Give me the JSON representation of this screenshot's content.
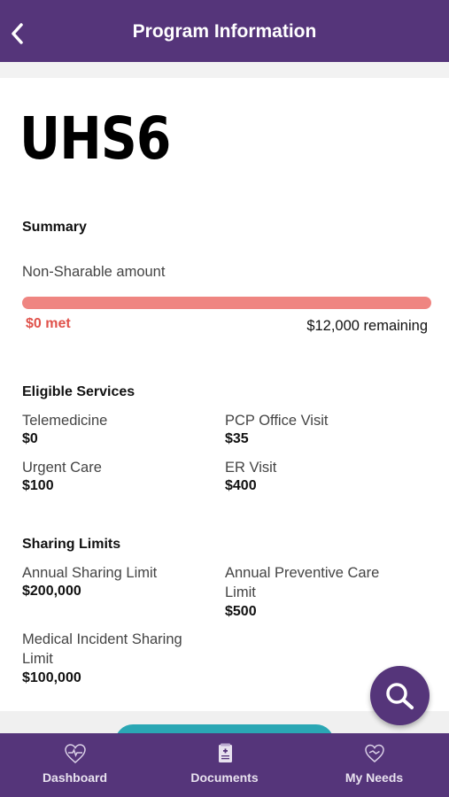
{
  "header": {
    "title": "Program Information"
  },
  "program": {
    "name": "UHS6"
  },
  "summary": {
    "title": "Summary",
    "label": "Non-Sharable amount",
    "met": "$0 met",
    "remaining": "$12,000 remaining",
    "progress_fraction": 0.0,
    "colors": {
      "track": "#ef8581",
      "met": "#e0524b"
    }
  },
  "eligible": {
    "title": "Eligible Services",
    "items": [
      {
        "label": "Telemedicine",
        "value": "$0"
      },
      {
        "label": "PCP Office Visit",
        "value": "$35"
      },
      {
        "label": "Urgent Care",
        "value": "$100"
      },
      {
        "label": "ER Visit",
        "value": "$400"
      }
    ]
  },
  "limits": {
    "title": "Sharing Limits",
    "items": [
      {
        "label": "Annual Sharing Limit",
        "value": "$200,000"
      },
      {
        "label": "Annual Preventive Care Limit",
        "value": "$500"
      },
      {
        "label": "Medical Incident Sharing Limit",
        "value": "$100,000"
      }
    ]
  },
  "tabs": [
    {
      "label": "Dashboard",
      "icon": "heart-pulse-icon"
    },
    {
      "label": "Documents",
      "icon": "document-icon"
    },
    {
      "label": "My Needs",
      "icon": "heart-hands-icon"
    }
  ],
  "colors": {
    "brand": "#55357a",
    "accent": "#2aa7b4"
  }
}
